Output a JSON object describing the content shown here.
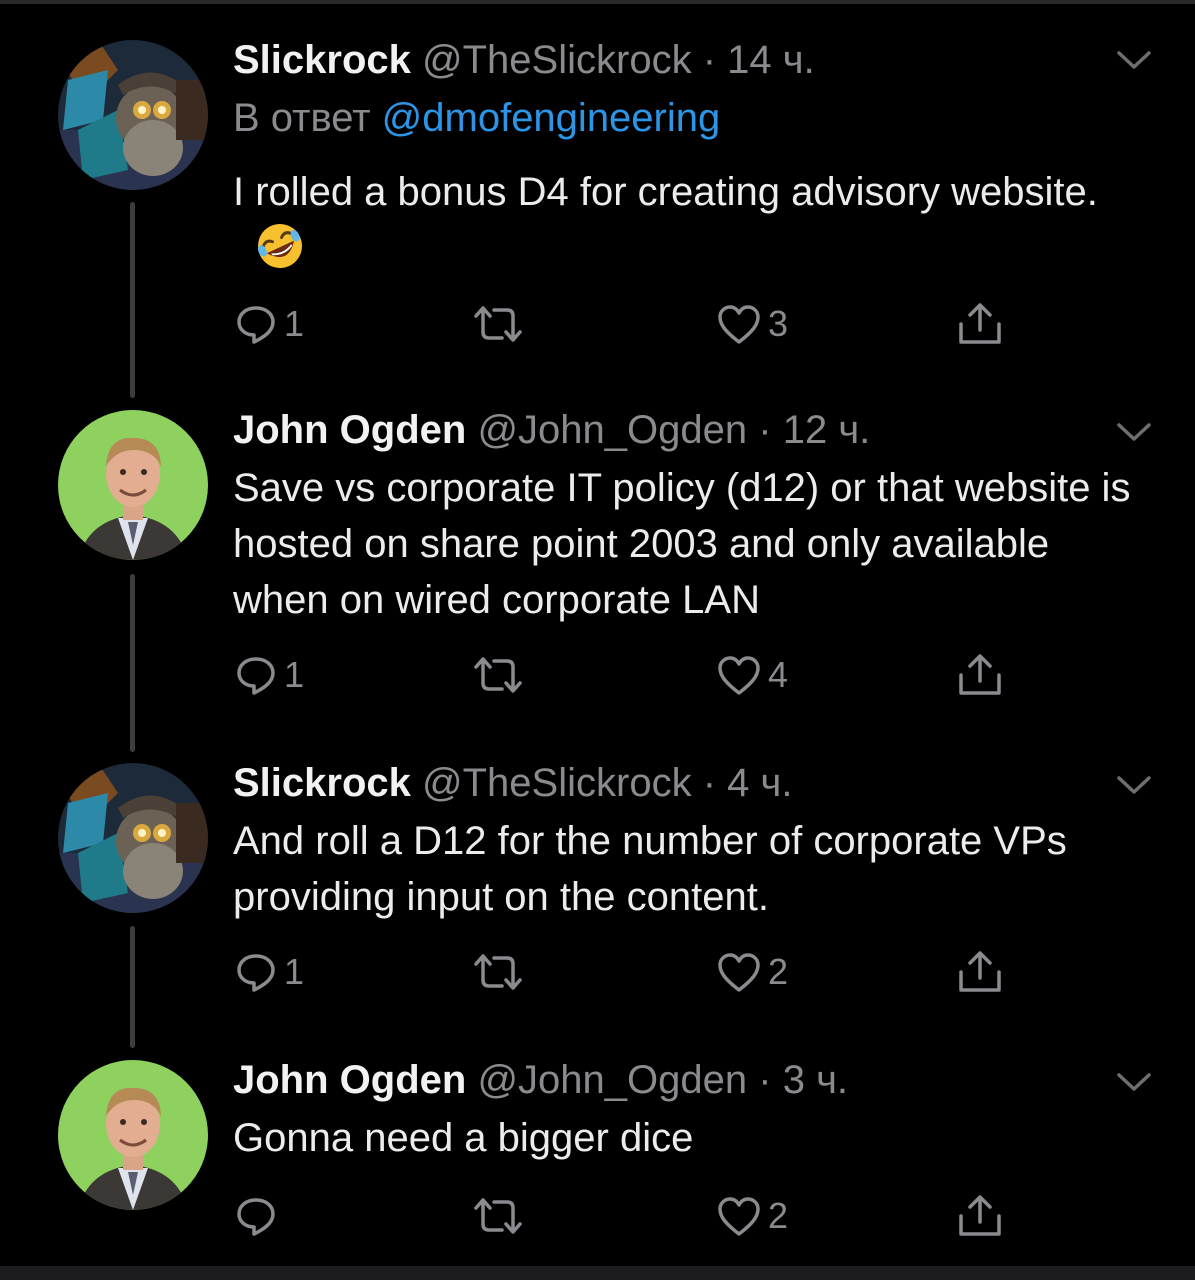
{
  "tweets": [
    {
      "name": "Slickrock",
      "handle": "@TheSlickrock",
      "separator": "·",
      "time": "14 ч.",
      "reply_prefix": "В ответ",
      "reply_to": "@dmofengineering",
      "text": "I rolled a bonus D4 for creating advisory website.",
      "emoji": "rolling-on-floor-laughing-emoji",
      "avatar": "dwarf-engineer-avatar",
      "reply_count": "1",
      "retweet_count": "",
      "like_count": "3"
    },
    {
      "name": "John Ogden",
      "handle": "@John_Ogden",
      "separator": "·",
      "time": "12 ч.",
      "text": "Save vs corporate IT policy (d12) or that website is hosted on share point 2003 and only available when on wired corporate LAN",
      "avatar": "man-green-background-avatar",
      "reply_count": "1",
      "retweet_count": "",
      "like_count": "4"
    },
    {
      "name": "Slickrock",
      "handle": "@TheSlickrock",
      "separator": "·",
      "time": "4 ч.",
      "text": "And roll a D12 for the number of corporate VPs providing input on the content.",
      "avatar": "dwarf-engineer-avatar",
      "reply_count": "1",
      "retweet_count": "",
      "like_count": "2"
    },
    {
      "name": "John Ogden",
      "handle": "@John_Ogden",
      "separator": "·",
      "time": "3 ч.",
      "text": "Gonna need a bigger dice",
      "avatar": "man-green-background-avatar",
      "reply_count": "",
      "retweet_count": "",
      "like_count": "2"
    }
  ],
  "colors": {
    "background": "#000000",
    "link": "#2d95e6",
    "muted": "#8b8b8f",
    "text": "#ececec"
  }
}
